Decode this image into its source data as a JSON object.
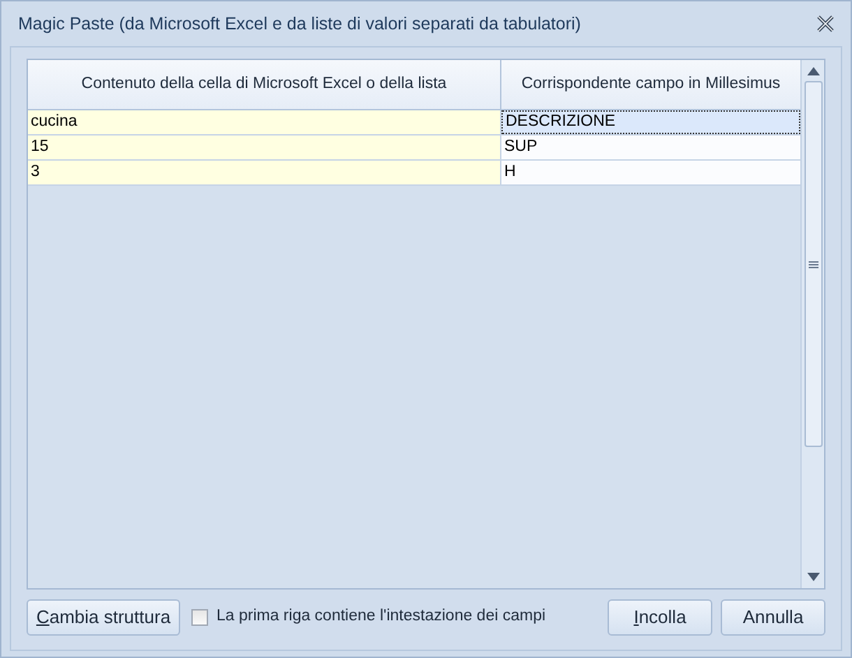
{
  "window": {
    "title": "Magic Paste (da Microsoft Excel e da liste di valori separati da tabulatori)"
  },
  "table": {
    "columns": [
      "Contenuto della cella di Microsoft Excel o della lista",
      "Corrispondente campo in Millesimus"
    ],
    "rows": [
      {
        "cells": [
          "cucina",
          "DESCRIZIONE"
        ],
        "selected": true
      },
      {
        "cells": [
          "15",
          "SUP"
        ],
        "selected": false
      },
      {
        "cells": [
          "3",
          "H"
        ],
        "selected": false
      }
    ]
  },
  "footer": {
    "structure_button": {
      "label": "Cambia struttura",
      "underline_first": true
    },
    "header_checkbox": {
      "label": "La prima riga contiene l'intestazione dei campi",
      "checked": false
    },
    "buttons": [
      {
        "label": "Incolla",
        "underline_first": true
      },
      {
        "label": "Annulla",
        "underline_first": false
      }
    ]
  }
}
